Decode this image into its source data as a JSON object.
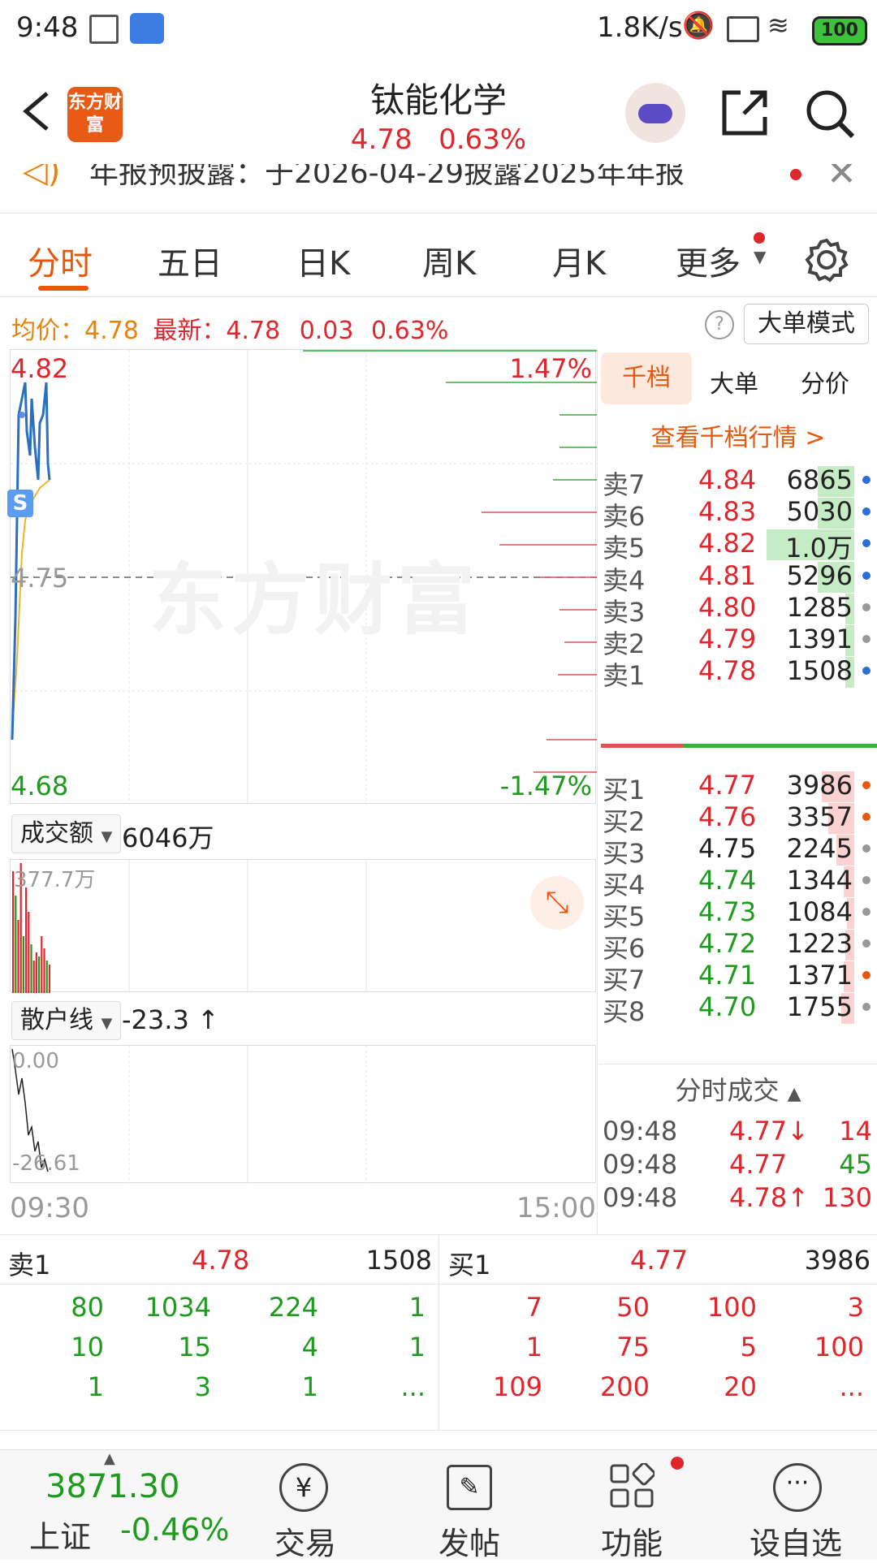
{
  "status_bar": {
    "time": "9:48",
    "net_speed": "1.8K/s",
    "battery": "100"
  },
  "header": {
    "logo_text": "东方财富",
    "title": "钛能化学",
    "price": "4.78",
    "change_pct": "0.63%"
  },
  "notice": {
    "text": "年报预披露：于2026-04-29披露2025年年报"
  },
  "tabs": [
    {
      "label": "分时",
      "active": true
    },
    {
      "label": "五日"
    },
    {
      "label": "日K"
    },
    {
      "label": "周K"
    },
    {
      "label": "月K"
    },
    {
      "label": "更多"
    }
  ],
  "info": {
    "avg_label": "均价：",
    "avg_value": "4.78",
    "latest_label": "最新：",
    "latest_value": "4.78",
    "change": "0.03",
    "change_pct": "0.63%",
    "mode_button": "大单模式"
  },
  "chart": {
    "high": "4.82",
    "low": "4.68",
    "mid": "4.75",
    "high_pct": "1.47%",
    "low_pct": "-1.47%",
    "watermark": "东方财富",
    "s_badge": "S"
  },
  "volume": {
    "selector": "成交额",
    "total": "6046万",
    "max_label": "377.7万"
  },
  "retail": {
    "selector": "散户线",
    "value": "-23.3",
    "arrow": "↑",
    "top_label": "0.00",
    "bottom_label": "-26.61"
  },
  "time_axis": {
    "start": "09:30",
    "end": "15:00"
  },
  "orderbook": {
    "tabs": [
      "千档",
      "大单",
      "分价"
    ],
    "link": "查看千档行情 >",
    "asks": [
      {
        "label": "卖7",
        "price": "4.84",
        "vol": "6865",
        "fill": 0.25,
        "dot": "#2a6fd6"
      },
      {
        "label": "卖6",
        "price": "4.83",
        "vol": "5030",
        "fill": 0.25,
        "dot": "#2a6fd6"
      },
      {
        "label": "卖5",
        "price": "4.82",
        "vol": "1.0万",
        "fill": 0.6,
        "dot": "#2a6fd6"
      },
      {
        "label": "卖4",
        "price": "4.81",
        "vol": "5296",
        "fill": 0.25,
        "dot": "#2a6fd6"
      },
      {
        "label": "卖3",
        "price": "4.80",
        "vol": "1285",
        "fill": 0.06,
        "dot": "#999999"
      },
      {
        "label": "卖2",
        "price": "4.79",
        "vol": "1391",
        "fill": 0.06,
        "dot": "#999999"
      },
      {
        "label": "卖1",
        "price": "4.78",
        "vol": "1508",
        "fill": 0.06,
        "dot": "#2a6fd6"
      }
    ],
    "bids": [
      {
        "label": "买1",
        "price": "4.77",
        "vol": "3986",
        "fill": 0.22,
        "dot": "#e8580c"
      },
      {
        "label": "买2",
        "price": "4.76",
        "vol": "3357",
        "fill": 0.18,
        "dot": "#e8580c"
      },
      {
        "label": "买3",
        "price": "4.75",
        "vol": "2245",
        "fill": 0.12,
        "dot": "#999999"
      },
      {
        "label": "买4",
        "price": "4.74",
        "vol": "1344",
        "fill": 0.07,
        "dot": "#999999"
      },
      {
        "label": "买5",
        "price": "4.73",
        "vol": "1084",
        "fill": 0.05,
        "dot": "#999999"
      },
      {
        "label": "买6",
        "price": "4.72",
        "vol": "1223",
        "fill": 0.06,
        "dot": "#999999"
      },
      {
        "label": "买7",
        "price": "4.71",
        "vol": "1371",
        "fill": 0.07,
        "dot": "#e8580c"
      },
      {
        "label": "买8",
        "price": "4.70",
        "vol": "1755",
        "fill": 0.09,
        "dot": "#999999"
      }
    ]
  },
  "ticks": {
    "title": "分时成交",
    "rows": [
      {
        "time": "09:48",
        "price": "4.77↓",
        "vol": "14"
      },
      {
        "time": "09:48",
        "price": "4.77",
        "vol": "45"
      },
      {
        "time": "09:48",
        "price": "4.78↑",
        "vol": "130"
      }
    ]
  },
  "depth": {
    "sell": {
      "label": "卖1",
      "price": "4.78",
      "vol": "1508",
      "rows": [
        [
          "80",
          "1034",
          "224",
          "1"
        ],
        [
          "10",
          "15",
          "4",
          "1"
        ],
        [
          "1",
          "3",
          "1",
          "..."
        ]
      ]
    },
    "buy": {
      "label": "买1",
      "price": "4.77",
      "vol": "3986",
      "rows": [
        [
          "7",
          "50",
          "100",
          "3"
        ],
        [
          "1",
          "75",
          "5",
          "100"
        ],
        [
          "109",
          "200",
          "20",
          "..."
        ]
      ]
    }
  },
  "nav": {
    "index_value": "3871.30",
    "index_name": "上证",
    "index_change": "-0.46%",
    "items": [
      "交易",
      "发帖",
      "功能",
      "设自选"
    ]
  }
}
